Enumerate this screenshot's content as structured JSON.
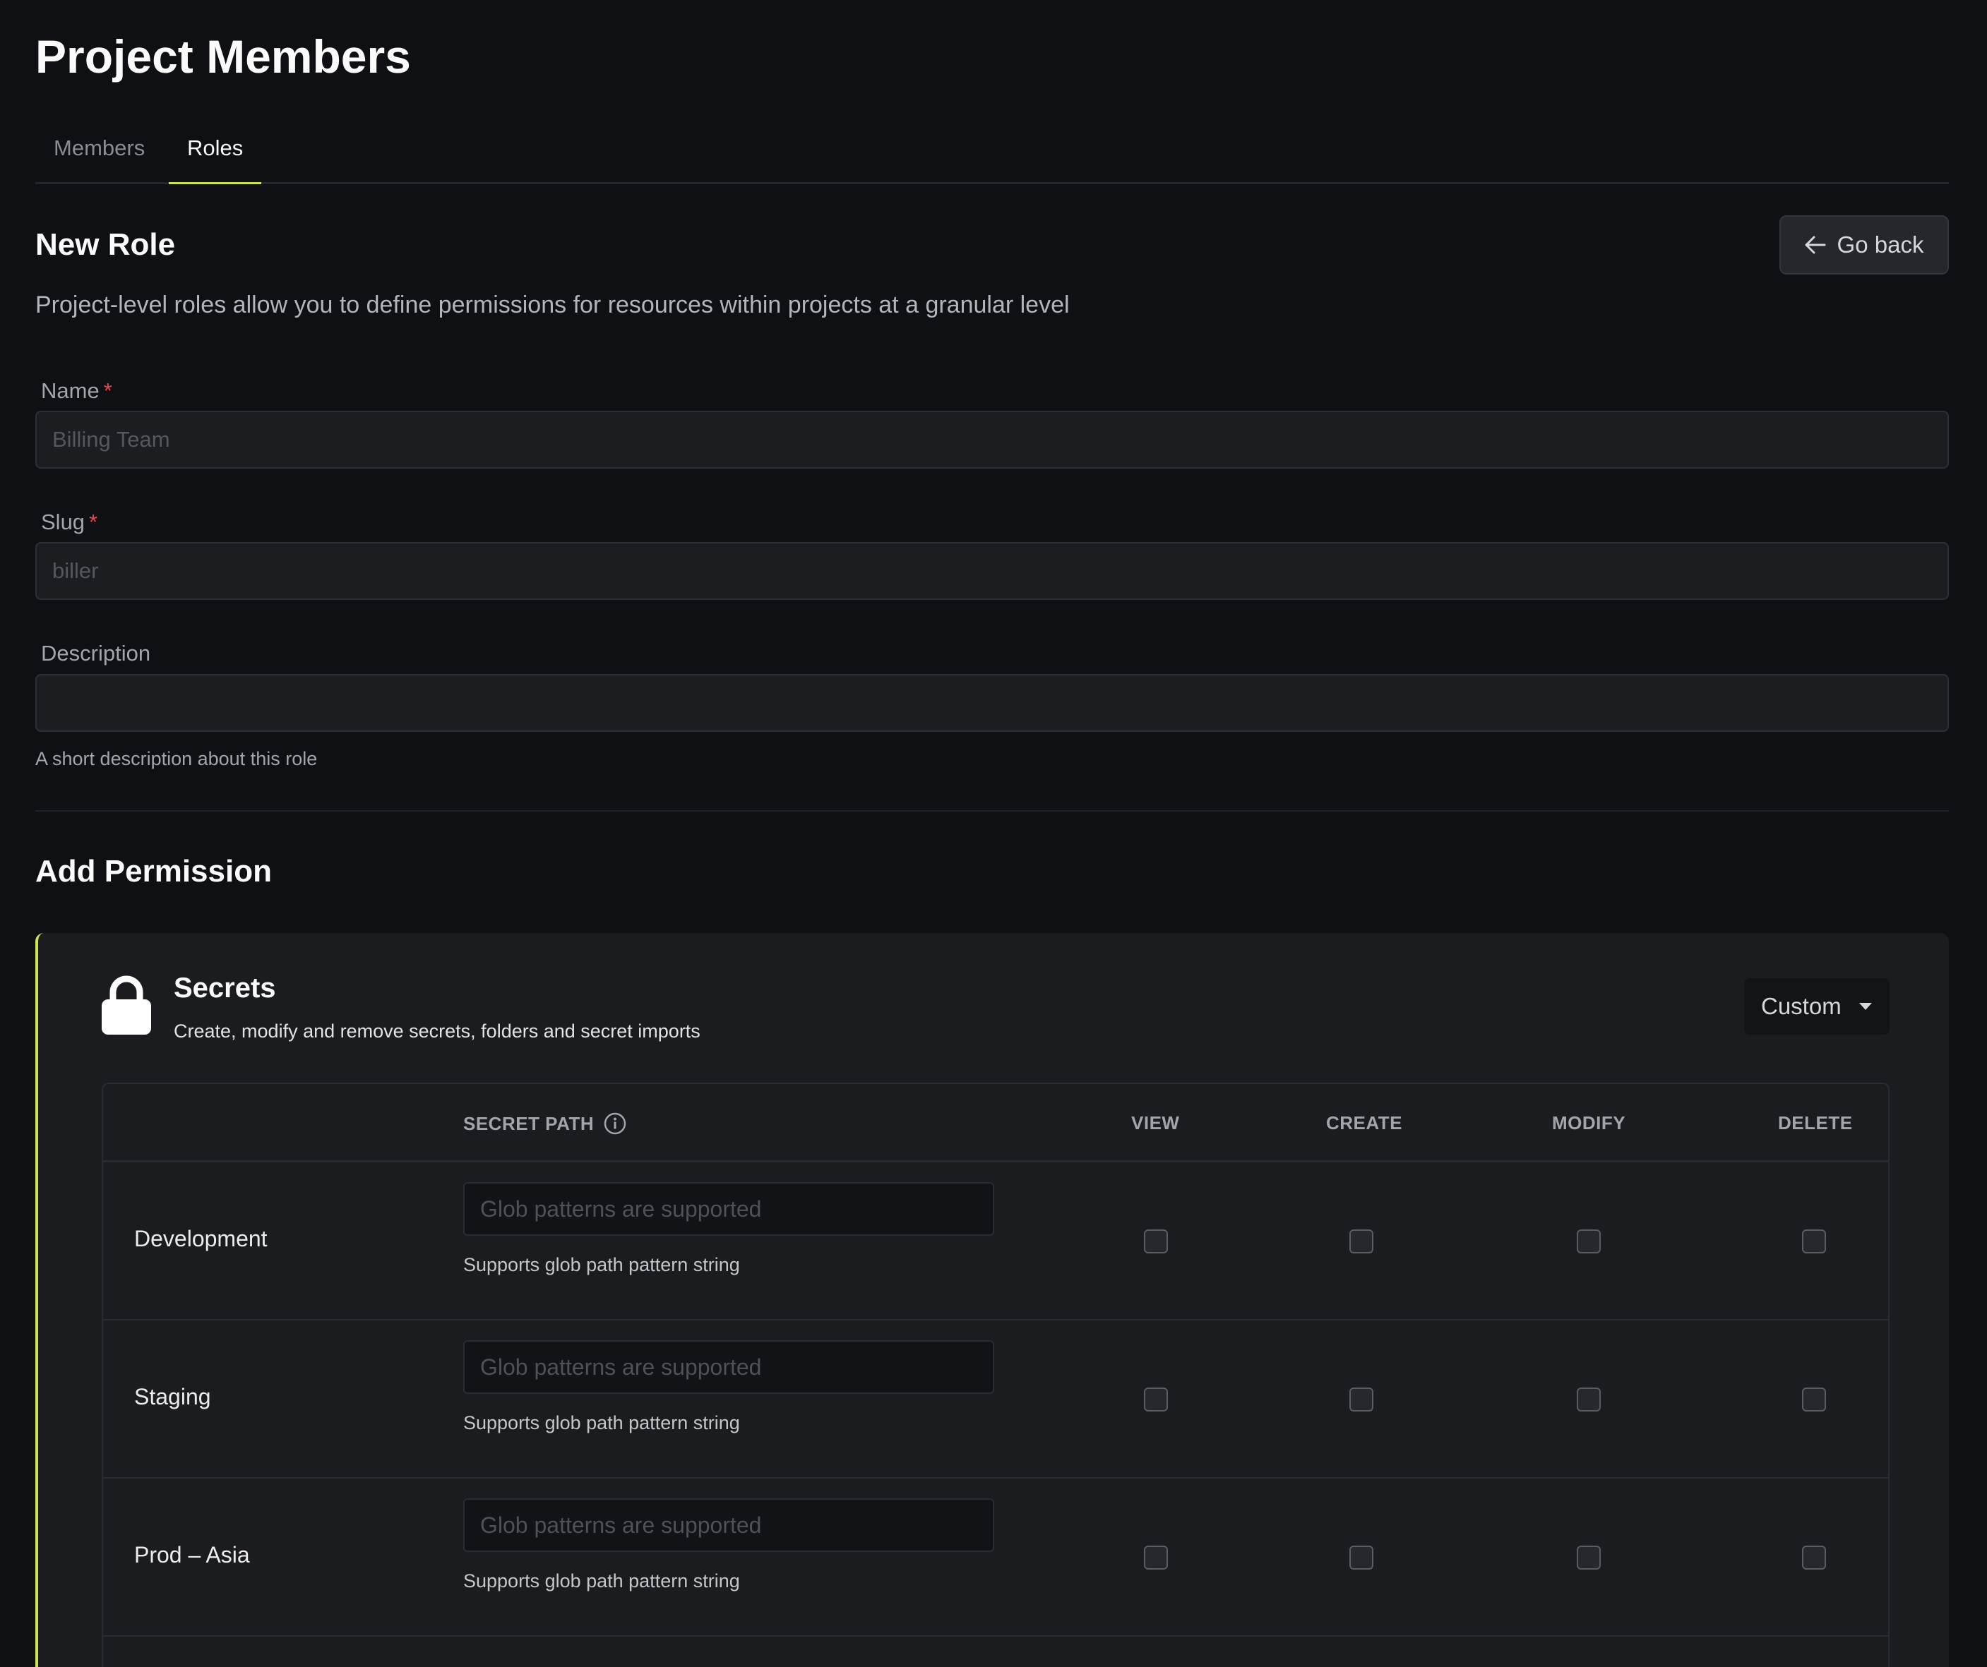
{
  "page": {
    "title": "Project Members"
  },
  "tabs": [
    {
      "label": "Members",
      "active": false
    },
    {
      "label": "Roles",
      "active": true
    }
  ],
  "role_form": {
    "heading": "New Role",
    "back_label": "Go back",
    "subtitle": "Project-level roles allow you to define permissions for resources within projects at a granular level",
    "name": {
      "label": "Name",
      "required_mark": "*",
      "placeholder": "Billing Team"
    },
    "slug": {
      "label": "Slug",
      "required_mark": "*",
      "placeholder": "biller"
    },
    "description": {
      "label": "Description",
      "placeholder": "",
      "help": "A short description about this role"
    }
  },
  "permissions": {
    "heading": "Add Permission",
    "accent_color": "#cfe54f",
    "card": {
      "icon": "lock-icon",
      "title": "Secrets",
      "description": "Create, modify and remove secrets, folders and secret imports",
      "mode": "Custom",
      "columns": [
        "SECRET PATH",
        "VIEW",
        "CREATE",
        "MODIFY",
        "DELETE"
      ],
      "path_placeholder": "Glob patterns are supported",
      "path_help": "Supports glob path pattern string",
      "rows": [
        {
          "environment": "Development"
        },
        {
          "environment": "Staging"
        },
        {
          "environment": "Prod – Asia"
        }
      ]
    }
  }
}
